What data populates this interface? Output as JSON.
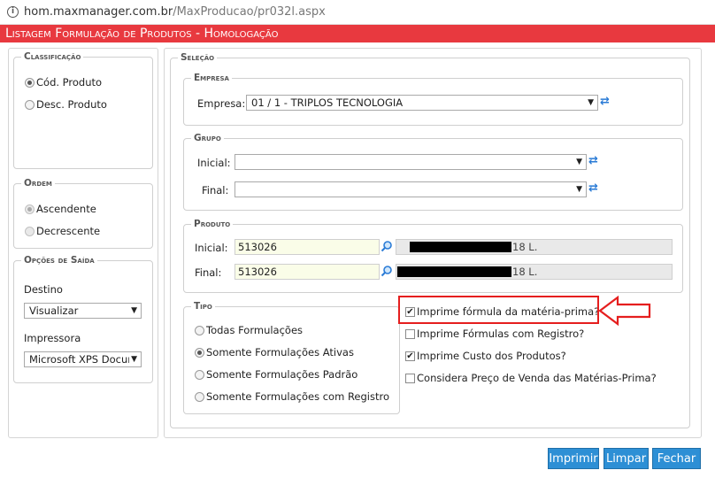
{
  "browser": {
    "host": "hom.maxmanager.com.br",
    "path": "/MaxProducao/pr032l.aspx"
  },
  "title": "Listagem Formulação de Produtos   - Homologação",
  "classificacao": {
    "legend": "Classificação",
    "options": [
      "Cód. Produto",
      "Desc. Produto"
    ],
    "selected": 0
  },
  "ordem": {
    "legend": "Ordem",
    "options": [
      "Ascendente",
      "Decrescente"
    ],
    "selected": 0
  },
  "opcoes_saida": {
    "legend": "Opções de Saída",
    "destino_label": "Destino",
    "destino_value": "Visualizar",
    "impressora_label": "Impressora",
    "impressora_value": "Microsoft XPS Docur"
  },
  "selecao": {
    "legend": "Seleção",
    "empresa": {
      "legend": "Empresa",
      "label": "Empresa:",
      "value": "01 / 1 - TRIPLOS TECNOLOGIA"
    },
    "grupo": {
      "legend": "Grupo",
      "inicial_label": "Inicial:",
      "final_label": "Final:",
      "inicial_value": "",
      "final_value": ""
    },
    "produto": {
      "legend": "Produto",
      "inicial_label": "Inicial:",
      "inicial_code": "513026",
      "inicial_desc_suffix": "18 L.",
      "final_label": "Final:",
      "final_code": "513026",
      "final_desc_suffix": "18 L."
    },
    "tipo": {
      "legend": "Tipo",
      "options": [
        "Todas Formulações",
        "Somente Formulações Ativas",
        "Somente Formulações Padrão",
        "Somente Formulações com Registro"
      ],
      "selected": 1
    },
    "checks": [
      {
        "label": "Imprime fórmula da matéria-prima?",
        "checked": true
      },
      {
        "label": "Imprime Fórmulas com Registro?",
        "checked": false
      },
      {
        "label": "Imprime Custo dos Produtos?",
        "checked": true
      },
      {
        "label": "Considera Preço de Venda das Matérias-Prima?",
        "checked": false
      }
    ]
  },
  "buttons": {
    "imprimir": "Imprimir",
    "limpar": "Limpar",
    "fechar": "Fechar"
  },
  "colors": {
    "title_bar": "#e8393f",
    "button": "#2d8fd5",
    "highlight": "#e51e1e"
  }
}
